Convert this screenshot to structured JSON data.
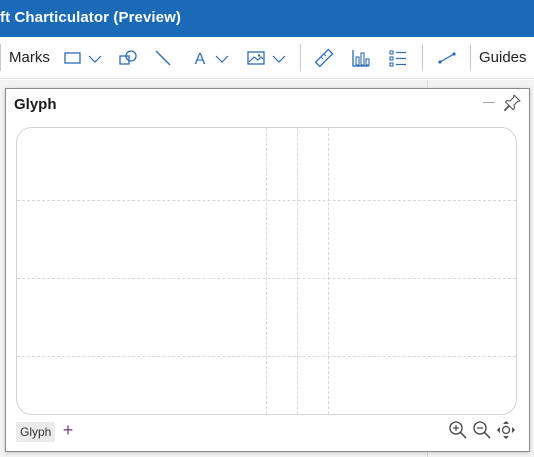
{
  "app": {
    "title": "ft Charticulator (Preview)",
    "accent_color": "#1b6ab8"
  },
  "toolbar": {
    "marks_label": "Marks",
    "guides_label": "Guides",
    "icons": [
      "rectangle-icon",
      "chevron-down-icon",
      "shapes-icon",
      "line-icon",
      "text-icon",
      "chevron-down-icon",
      "image-icon",
      "chevron-down-icon",
      "ruler-icon",
      "data-axis-icon",
      "legend-icon",
      "link-icon"
    ]
  },
  "glyph_panel": {
    "title": "Glyph",
    "tabs": [
      {
        "label": "Glyph"
      }
    ],
    "add_label": "+",
    "zoom_icons": [
      "zoom-in-icon",
      "zoom-out-icon",
      "zoom-fit-icon"
    ]
  }
}
